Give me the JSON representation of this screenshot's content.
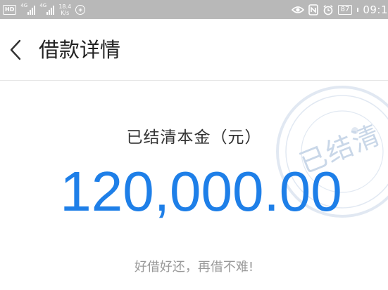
{
  "status_bar": {
    "hd_badge": "HD",
    "sim1_network": "4G",
    "sim2_network": "4G",
    "speed_value": "18.4",
    "speed_unit": "K/s",
    "battery_level": "87",
    "time": "09:1",
    "icons": [
      "hd-icon",
      "signal-icon",
      "signal-icon",
      "sync-icon",
      "eye-icon",
      "nfc-icon",
      "alarm-icon",
      "battery-icon"
    ]
  },
  "header": {
    "title": "借款详情",
    "back_icon": "chevron-left-icon"
  },
  "main": {
    "amount_label": "已结清本金（元）",
    "amount_value": "120,000.00",
    "slogan": "好借好还，再借不难!",
    "stamp_text": "已结清"
  },
  "colors": {
    "accent": "#1e7fe8",
    "status_bar_bg": "#b8b8b8",
    "title_text": "#222222",
    "slogan_text": "#999999",
    "stamp": "#c9d7e8"
  }
}
